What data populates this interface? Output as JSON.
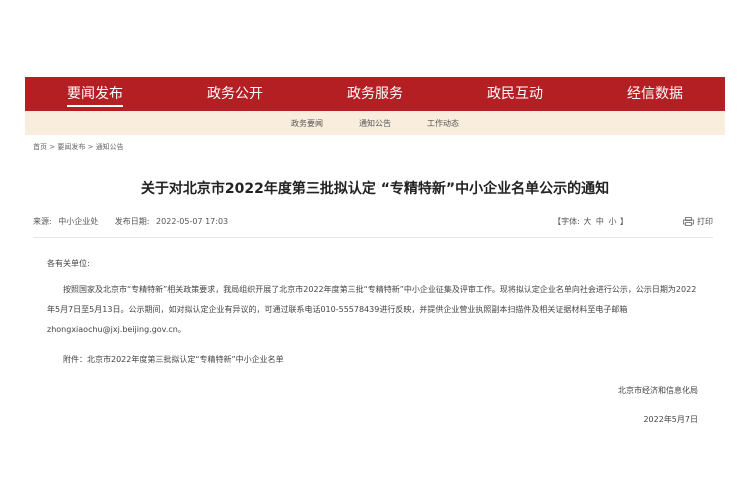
{
  "nav": {
    "items": [
      {
        "label": "要闻发布"
      },
      {
        "label": "政务公开"
      },
      {
        "label": "政务服务"
      },
      {
        "label": "政民互动"
      },
      {
        "label": "经信数据"
      }
    ],
    "active_color": "#b41f24"
  },
  "subnav": {
    "items": [
      {
        "label": "政务要闻"
      },
      {
        "label": "通知公告"
      },
      {
        "label": "工作动态"
      }
    ]
  },
  "breadcrumb": {
    "items": [
      "首页",
      "要闻发布",
      "通知公告"
    ],
    "separator": ">"
  },
  "article": {
    "title": "关于对北京市2022年度第三批拟认定 “专精特新”中小企业名单公示的通知",
    "source_label": "来源:",
    "source": "中小企业处",
    "date_label": "发布日期:",
    "date": "2022-05-07 17:03",
    "font_size_prefix": "【字体:",
    "font_size_options": [
      "大",
      "中",
      "小"
    ],
    "font_size_suffix": "】",
    "print_label": "打印",
    "salutation": "各有关单位:",
    "paragraphs": [
      "按照国家及北京市“专精特新”相关政策要求，我局组织开展了北京市2022年度第三批“专精特新”中小企业征集及评审工作。现将拟认定企业名单向社会进行公示，公示日期为2022年5月7日至5月13日。公示期间，如对拟认定企业有异议的，可通过联系电话010-55578439进行反映，并提供企业营业执照副本扫描件及相关证据材料至电子邮箱zhongxiaochu@jxj.beijing.gov.cn。"
    ],
    "attachment": "附件：北京市2022年度第三批拟认定“专精特新”中小企业名单",
    "signature": "北京市经济和信息化局",
    "sign_date": "2022年5月7日"
  }
}
